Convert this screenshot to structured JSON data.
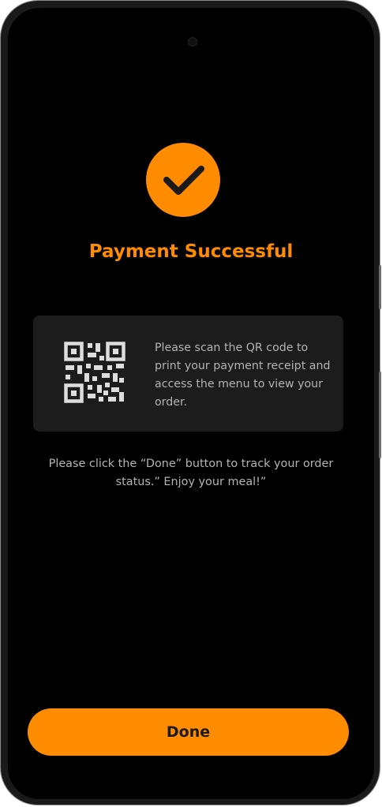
{
  "status": {
    "title": "Payment Successful",
    "icon": "check-circle-icon"
  },
  "qr_card": {
    "icon": "qr-code-icon",
    "message": "Please scan the QR code to print your payment receipt and access the menu to view your order."
  },
  "info": {
    "message": "Please click the “Done” button to track your order status.” Enjoy your meal!”"
  },
  "actions": {
    "done_label": "Done"
  },
  "colors": {
    "accent": "#ff8c00",
    "background": "#000000",
    "card": "#1c1c1c",
    "muted_text": "#b3b3b3"
  }
}
